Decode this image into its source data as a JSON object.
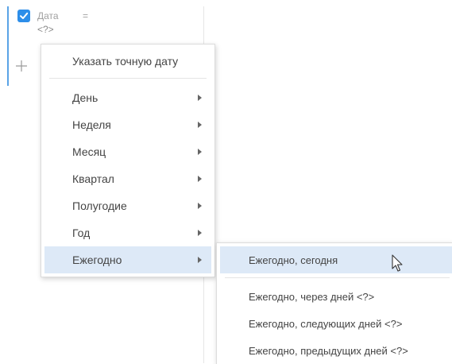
{
  "filter": {
    "field": "Дата",
    "operator": "=",
    "value": "<?>",
    "checked": true,
    "add_icon": "plus-icon"
  },
  "menu": {
    "exact_date": "Указать точную дату",
    "items": [
      {
        "label": "День"
      },
      {
        "label": "Неделя"
      },
      {
        "label": "Месяц"
      },
      {
        "label": "Квартал"
      },
      {
        "label": "Полугодие"
      },
      {
        "label": "Год"
      },
      {
        "label": "Ежегодно",
        "active": true
      }
    ]
  },
  "submenu": {
    "items": [
      {
        "label": "Ежегодно, сегодня",
        "active": true
      },
      {
        "label": "Ежегодно, через дней <?>"
      },
      {
        "label": "Ежегодно, следующих дней <?>"
      },
      {
        "label": "Ежегодно, предыдущих дней <?>"
      }
    ]
  },
  "colors": {
    "accent": "#2d8ee9",
    "highlight": "#dde9f7",
    "left_rule": "#5aa4e6"
  }
}
